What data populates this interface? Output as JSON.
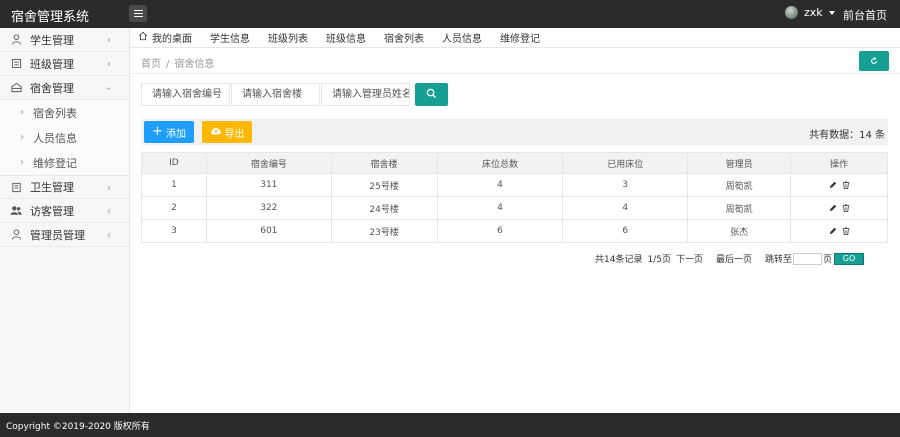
{
  "app": {
    "title": "宿舍管理系统"
  },
  "header": {
    "user": "zxk",
    "home_link": "前台首页"
  },
  "sidebar": {
    "items": [
      {
        "label": "学生管理",
        "icon": "user-icon"
      },
      {
        "label": "班级管理",
        "icon": "class-icon"
      },
      {
        "label": "宿舍管理",
        "icon": "dorm-icon"
      }
    ],
    "sub_items": [
      {
        "label": "宿舍列表"
      },
      {
        "label": "人员信息"
      },
      {
        "label": "维修登记"
      }
    ],
    "items_after": [
      {
        "label": "卫生管理",
        "icon": "hygiene-icon"
      },
      {
        "label": "访客管理",
        "icon": "visitor-icon"
      },
      {
        "label": "管理员管理",
        "icon": "admin-icon"
      }
    ]
  },
  "tabs": [
    {
      "label": "我的桌面"
    },
    {
      "label": "学生信息"
    },
    {
      "label": "班级列表"
    },
    {
      "label": "班级信息"
    },
    {
      "label": "宿舍列表"
    },
    {
      "label": "人员信息"
    },
    {
      "label": "维修登记"
    }
  ],
  "breadcrumb": {
    "home": "首页",
    "sep": "/",
    "current": "宿舍信息"
  },
  "search": {
    "dorm_no_placeholder": "请输入宿舍编号",
    "building_placeholder": "请输入宿舍楼",
    "manager_placeholder": "请输入管理员姓名"
  },
  "toolbar": {
    "add_label": "添加",
    "export_label": "导出",
    "total_text": "共有数据：14 条"
  },
  "table": {
    "headers": [
      "ID",
      "宿舍编号",
      "宿舍楼",
      "床位总数",
      "已用床位",
      "管理员",
      "操作"
    ],
    "rows": [
      {
        "id": "1",
        "dorm_no": "311",
        "building": "25号楼",
        "beds_total": "4",
        "beds_used": "3",
        "manager": "周筍凯"
      },
      {
        "id": "2",
        "dorm_no": "322",
        "building": "24号楼",
        "beds_total": "4",
        "beds_used": "4",
        "manager": "周筍凯"
      },
      {
        "id": "3",
        "dorm_no": "601",
        "building": "23号楼",
        "beds_total": "6",
        "beds_used": "6",
        "manager": "张杰"
      }
    ]
  },
  "pager": {
    "records": "共14条记录",
    "page": "1/5页",
    "next": "下一页",
    "last": "最后一页",
    "jump_to": "跳转至",
    "page_unit": "页",
    "go": "GO"
  },
  "footer": {
    "copyright": "Copyright ©2019-2020 版权所有"
  },
  "colors": {
    "accent": "#16a094",
    "add": "#1e9fff",
    "export": "#ffb800",
    "topbar": "#2b2b2b"
  }
}
